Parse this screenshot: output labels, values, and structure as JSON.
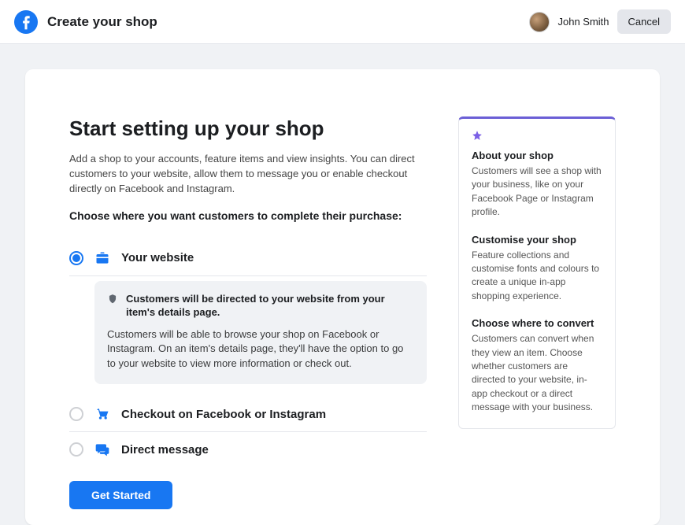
{
  "header": {
    "title": "Create your shop",
    "user_name": "John Smith",
    "cancel_label": "Cancel"
  },
  "main": {
    "heading": "Start setting up your shop",
    "intro": "Add a shop to your accounts, feature items and view insights. You can direct customers to your website, allow them to message you or enable checkout directly on Facebook and Instagram.",
    "subheading": "Choose where you want customers to complete their purchase:",
    "options": [
      {
        "label": "Your website",
        "selected": true
      },
      {
        "label": "Checkout on Facebook or Instagram",
        "selected": false
      },
      {
        "label": "Direct message",
        "selected": false
      }
    ],
    "info_card": {
      "title": "Customers will be directed to your website from your item's details page.",
      "body": "Customers will be able to browse your shop on Facebook or Instagram. On an item's details page, they'll have the option to go to your website to view more information or check out."
    },
    "cta_label": "Get Started"
  },
  "sidebar": {
    "blocks": [
      {
        "title": "About your shop",
        "text": "Customers will see a shop with your business, like on your Facebook Page or Instagram profile."
      },
      {
        "title": "Customise your shop",
        "text": "Feature collections and customise fonts and colours to create a unique in-app shopping experience."
      },
      {
        "title": "Choose where to convert",
        "text": "Customers can convert when they view an item. Choose whether customers are directed to your website, in-app checkout or a direct message with your business."
      }
    ]
  }
}
